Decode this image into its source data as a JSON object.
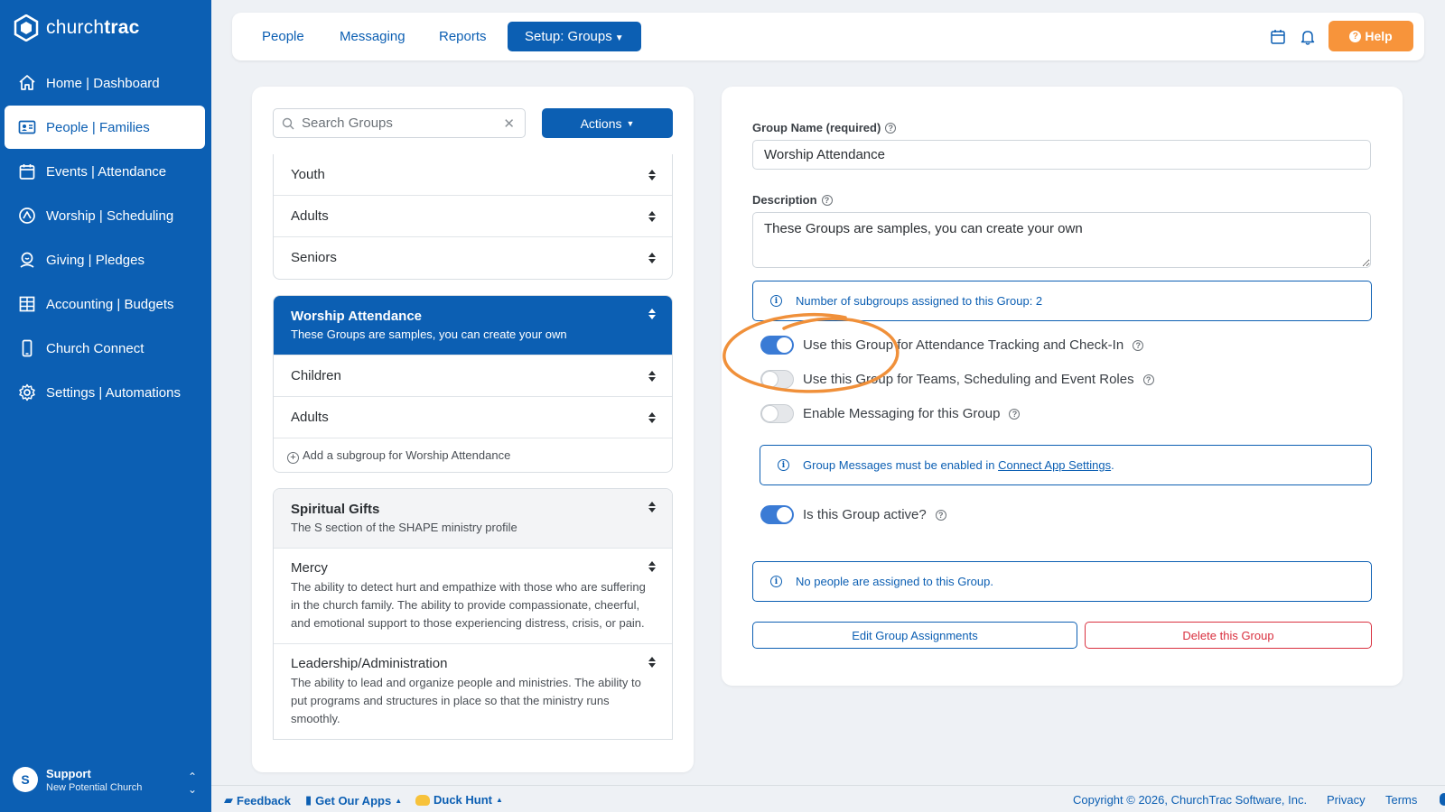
{
  "brand": {
    "name_regular": "church",
    "name_bold": "trac",
    "logo_icon": "churchtrac-logo-icon"
  },
  "sidebar": {
    "items": [
      {
        "label": "Home | Dashboard",
        "icon": "home-icon"
      },
      {
        "label": "People | Families",
        "icon": "id-card-icon",
        "active": true
      },
      {
        "label": "Events | Attendance",
        "icon": "calendar-icon"
      },
      {
        "label": "Worship | Scheduling",
        "icon": "compass-icon"
      },
      {
        "label": "Giving | Pledges",
        "icon": "donation-icon"
      },
      {
        "label": "Accounting | Budgets",
        "icon": "grid-icon"
      },
      {
        "label": "Church Connect",
        "icon": "mobile-icon"
      },
      {
        "label": "Settings | Automations",
        "icon": "gear-icon"
      }
    ],
    "user": {
      "initial": "S",
      "name": "Support",
      "org": "New Potential Church"
    }
  },
  "topbar": {
    "tabs": [
      "People",
      "Messaging",
      "Reports"
    ],
    "active_tab": "Setup: Groups",
    "help_label": "Help"
  },
  "left": {
    "search": {
      "placeholder": "Search Groups",
      "value": ""
    },
    "actions_label": "Actions",
    "card1": [
      {
        "name": "Youth"
      },
      {
        "name": "Adults"
      },
      {
        "name": "Seniors"
      }
    ],
    "worship": {
      "name": "Worship Attendance",
      "desc": "These Groups are samples, you can create your own",
      "subgroups": [
        {
          "name": "Children"
        },
        {
          "name": "Adults"
        }
      ],
      "add_label": "Add a subgroup for Worship Attendance"
    },
    "spiritual": {
      "name": "Spiritual Gifts",
      "desc": "The S section of the SHAPE ministry profile",
      "subgroups": [
        {
          "name": "Mercy",
          "desc": "The ability to detect hurt and empathize with those who are suffering in the church family. The ability to provide compassionate, cheerful, and emotional support to those experiencing distress, crisis, or pain."
        },
        {
          "name": "Leadership/Administration",
          "desc": "The ability to lead and organize people and ministries. The ability to put programs and structures in place so that the ministry runs smoothly."
        }
      ]
    }
  },
  "detail": {
    "group_name_label": "Group Name (required)",
    "group_name_value": "Worship Attendance",
    "description_label": "Description",
    "description_value": "These Groups are samples, you can create your own",
    "subgroups_info": "Number of subgroups assigned to this Group: 2",
    "toggles": {
      "attendance": {
        "label": "Use this Group for Attendance Tracking and Check-In",
        "on": true
      },
      "teams": {
        "label": "Use this Group for Teams, Scheduling and Event Roles",
        "on": false
      },
      "messaging": {
        "label": "Enable Messaging for this Group",
        "on": false
      },
      "active": {
        "label": "Is this Group active?",
        "on": true
      }
    },
    "messages_info_prefix": "Group Messages must be enabled in ",
    "messages_info_link": "Connect App Settings",
    "messages_info_suffix": ".",
    "people_info": "No people are assigned to this Group.",
    "edit_button": "Edit Group Assignments",
    "delete_button": "Delete this Group"
  },
  "footer": {
    "feedback": "Feedback",
    "get_apps": "Get Our Apps",
    "duck_hunt": "Duck Hunt",
    "copyright": "Copyright © 2026, ChurchTrac Software, Inc.",
    "privacy": "Privacy",
    "terms": "Terms"
  },
  "colors": {
    "primary": "#0c5fb3",
    "help": "#f7943b",
    "danger": "#d9303f",
    "highlight_ring": "#f0903a"
  }
}
